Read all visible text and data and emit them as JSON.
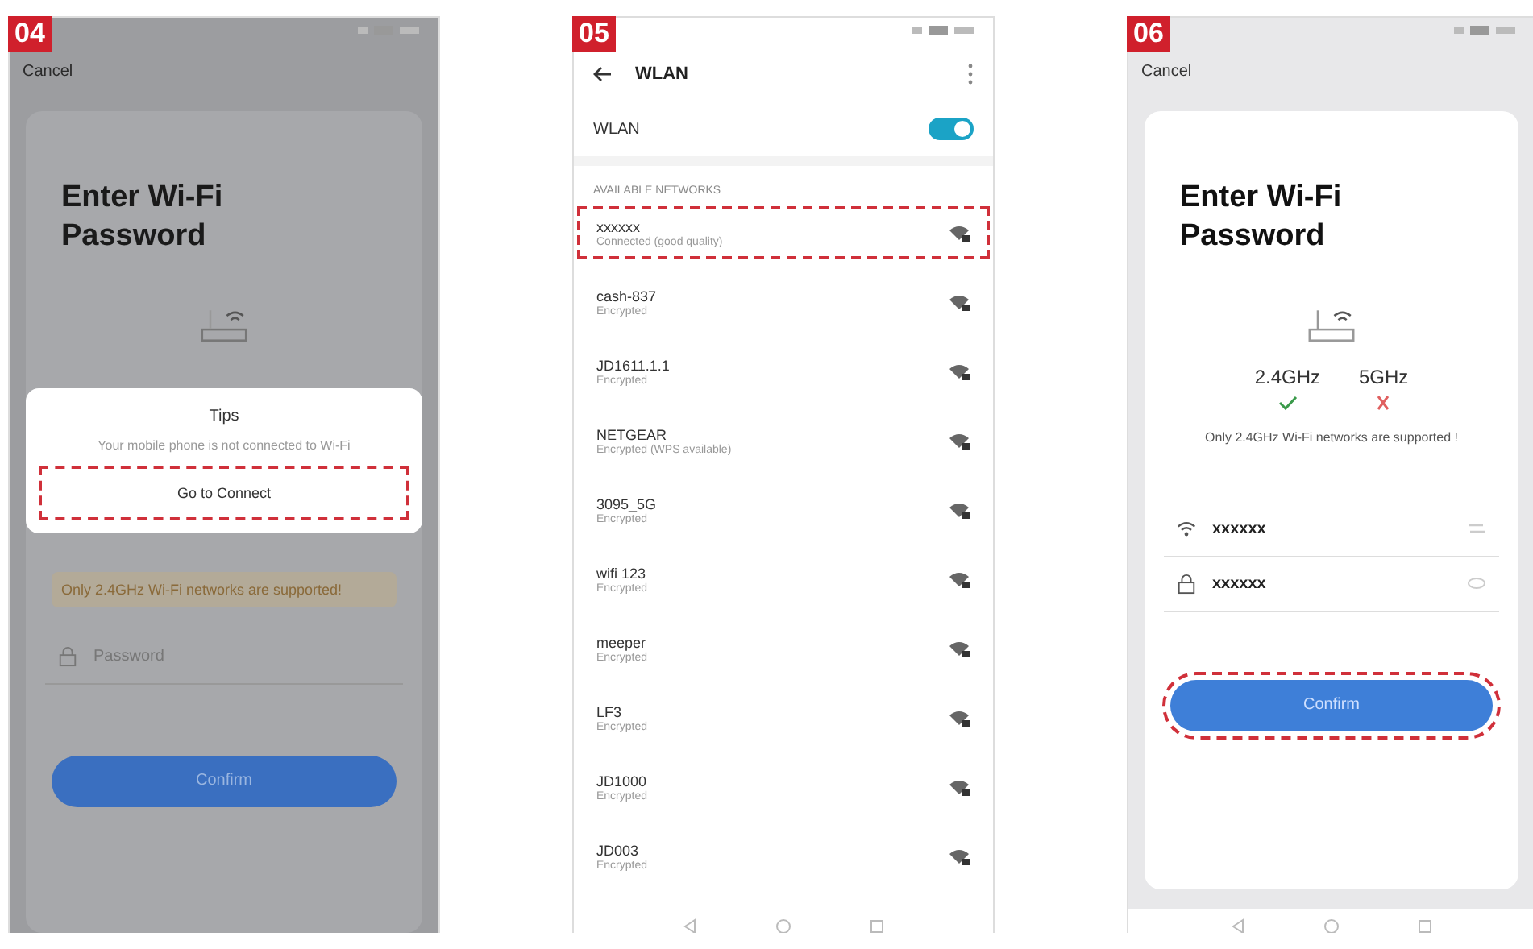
{
  "steps": [
    {
      "kind": "password_dialog",
      "number": "04",
      "cancel": "Cancel",
      "title": [
        "Enter Wi-Fi",
        "Password"
      ],
      "warning": "Only 2.4GHz Wi-Fi networks are supported!",
      "password_placeholder": "Password",
      "confirm": {
        "label": "Confirm",
        "highlighted": false
      },
      "dialog": {
        "title": "Tips",
        "message": "Your mobile phone is not connected to Wi-Fi",
        "button": {
          "label": "Go to Connect",
          "highlighted": true
        }
      }
    },
    {
      "kind": "wlan_list",
      "number": "05",
      "title": "WLAN",
      "wlan": {
        "label": "WLAN",
        "on": true
      },
      "section": "AVAILABLE NETWORKS",
      "networks": [
        {
          "name": "xxxxxx",
          "status": "Connected (good quality)",
          "highlighted": true
        },
        {
          "name": "cash-837",
          "status": "Encrypted",
          "highlighted": false
        },
        {
          "name": "JD1611.1.1",
          "status": "Encrypted",
          "highlighted": false
        },
        {
          "name": "NETGEAR",
          "status": "Encrypted (WPS available)",
          "highlighted": false
        },
        {
          "name": "3095_5G",
          "status": "Encrypted",
          "highlighted": false
        },
        {
          "name": "wifi 123",
          "status": "Encrypted",
          "highlighted": false
        },
        {
          "name": "meeper",
          "status": "Encrypted",
          "highlighted": false
        },
        {
          "name": "LF3",
          "status": "Encrypted",
          "highlighted": false
        },
        {
          "name": "JD1000",
          "status": "Encrypted",
          "highlighted": false
        },
        {
          "name": "JD003",
          "status": "Encrypted",
          "highlighted": false
        }
      ]
    },
    {
      "kind": "password_form",
      "number": "06",
      "cancel": "Cancel",
      "title": [
        "Enter Wi-Fi",
        "Password"
      ],
      "bands": [
        {
          "label": "2.4GHz",
          "supported": true
        },
        {
          "label": "5GHz",
          "supported": false
        }
      ],
      "warning": "Only 2.4GHz Wi-Fi networks are supported !",
      "wifi_name": "xxxxxx",
      "password": "xxxxxx",
      "confirm": {
        "label": "Confirm",
        "highlighted": true
      }
    }
  ]
}
